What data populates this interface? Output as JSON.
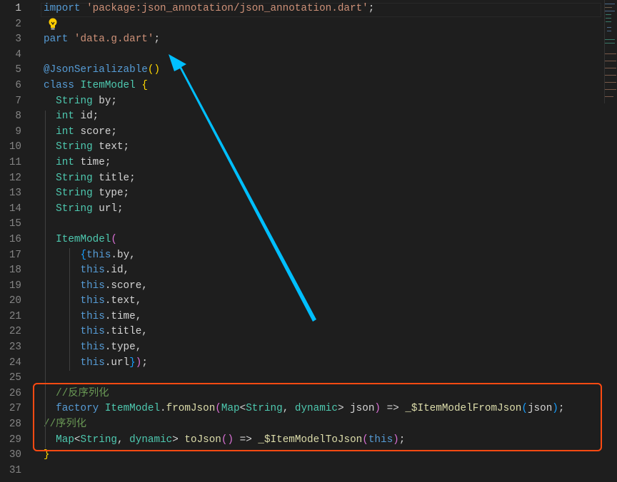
{
  "editor": {
    "active_line": 1,
    "lines": [
      [
        [
          "k",
          "import"
        ],
        [
          "d",
          " "
        ],
        [
          "s",
          "'package:json_annotation/json_annotation.dart'"
        ],
        [
          "d",
          ";"
        ]
      ],
      [],
      [
        [
          "k",
          "part"
        ],
        [
          "d",
          " "
        ],
        [
          "s",
          "'data.g.dart'"
        ],
        [
          "d",
          ";"
        ]
      ],
      [],
      [
        [
          "k",
          "@JsonSerializable"
        ],
        [
          "b1",
          "()"
        ]
      ],
      [
        [
          "k",
          "class"
        ],
        [
          "d",
          " "
        ],
        [
          "t",
          "ItemModel"
        ],
        [
          "d",
          " "
        ],
        [
          "b1",
          "{"
        ]
      ],
      [
        [
          "d",
          "  "
        ],
        [
          "t",
          "String"
        ],
        [
          "d",
          " by;"
        ]
      ],
      [
        [
          "d",
          "  "
        ],
        [
          "t",
          "int"
        ],
        [
          "d",
          " id;"
        ]
      ],
      [
        [
          "d",
          "  "
        ],
        [
          "t",
          "int"
        ],
        [
          "d",
          " score;"
        ]
      ],
      [
        [
          "d",
          "  "
        ],
        [
          "t",
          "String"
        ],
        [
          "d",
          " text;"
        ]
      ],
      [
        [
          "d",
          "  "
        ],
        [
          "t",
          "int"
        ],
        [
          "d",
          " time;"
        ]
      ],
      [
        [
          "d",
          "  "
        ],
        [
          "t",
          "String"
        ],
        [
          "d",
          " title;"
        ]
      ],
      [
        [
          "d",
          "  "
        ],
        [
          "t",
          "String"
        ],
        [
          "d",
          " type;"
        ]
      ],
      [
        [
          "d",
          "  "
        ],
        [
          "t",
          "String"
        ],
        [
          "d",
          " url;"
        ]
      ],
      [],
      [
        [
          "d",
          "  "
        ],
        [
          "t",
          "ItemModel"
        ],
        [
          "b2",
          "("
        ]
      ],
      [
        [
          "d",
          "      "
        ],
        [
          "b3",
          "{"
        ],
        [
          "k",
          "this"
        ],
        [
          "d",
          ".by,"
        ]
      ],
      [
        [
          "d",
          "      "
        ],
        [
          "k",
          "this"
        ],
        [
          "d",
          ".id,"
        ]
      ],
      [
        [
          "d",
          "      "
        ],
        [
          "k",
          "this"
        ],
        [
          "d",
          ".score,"
        ]
      ],
      [
        [
          "d",
          "      "
        ],
        [
          "k",
          "this"
        ],
        [
          "d",
          ".text,"
        ]
      ],
      [
        [
          "d",
          "      "
        ],
        [
          "k",
          "this"
        ],
        [
          "d",
          ".time,"
        ]
      ],
      [
        [
          "d",
          "      "
        ],
        [
          "k",
          "this"
        ],
        [
          "d",
          ".title,"
        ]
      ],
      [
        [
          "d",
          "      "
        ],
        [
          "k",
          "this"
        ],
        [
          "d",
          ".type,"
        ]
      ],
      [
        [
          "d",
          "      "
        ],
        [
          "k",
          "this"
        ],
        [
          "d",
          ".url"
        ],
        [
          "b3",
          "}"
        ],
        [
          "b2",
          ")"
        ],
        [
          "d",
          ";"
        ]
      ],
      [],
      [
        [
          "d",
          "  "
        ],
        [
          "c",
          "//反序列化"
        ]
      ],
      [
        [
          "d",
          "  "
        ],
        [
          "k",
          "factory"
        ],
        [
          "d",
          " "
        ],
        [
          "t",
          "ItemModel"
        ],
        [
          "d",
          "."
        ],
        [
          "f",
          "fromJson"
        ],
        [
          "b2",
          "("
        ],
        [
          "t",
          "Map"
        ],
        [
          "d",
          "<"
        ],
        [
          "t",
          "String"
        ],
        [
          "d",
          ", "
        ],
        [
          "t",
          "dynamic"
        ],
        [
          "d",
          "> json"
        ],
        [
          "b2",
          ")"
        ],
        [
          "d",
          " => "
        ],
        [
          "f",
          "_$ItemModelFromJson"
        ],
        [
          "b3",
          "("
        ],
        [
          "d",
          "json"
        ],
        [
          "b3",
          ")"
        ],
        [
          "d",
          ";"
        ]
      ],
      [
        [
          "c",
          "//序列化"
        ]
      ],
      [
        [
          "d",
          "  "
        ],
        [
          "t",
          "Map"
        ],
        [
          "d",
          "<"
        ],
        [
          "t",
          "String"
        ],
        [
          "d",
          ", "
        ],
        [
          "t",
          "dynamic"
        ],
        [
          "d",
          "> "
        ],
        [
          "f",
          "toJson"
        ],
        [
          "b2",
          "()"
        ],
        [
          "d",
          " => "
        ],
        [
          "f",
          "_$ItemModelToJson"
        ],
        [
          "b2",
          "("
        ],
        [
          "k",
          "this"
        ],
        [
          "b2",
          ")"
        ],
        [
          "d",
          ";"
        ]
      ],
      [
        [
          "b1",
          "}"
        ]
      ],
      []
    ]
  },
  "icons": {
    "lightbulb": "lightbulb-icon",
    "arrow": "annotation-arrow"
  },
  "colors": {
    "arrow": "#00bfff",
    "highlight_box": "#ff4a12",
    "background": "#1e1e1e"
  }
}
